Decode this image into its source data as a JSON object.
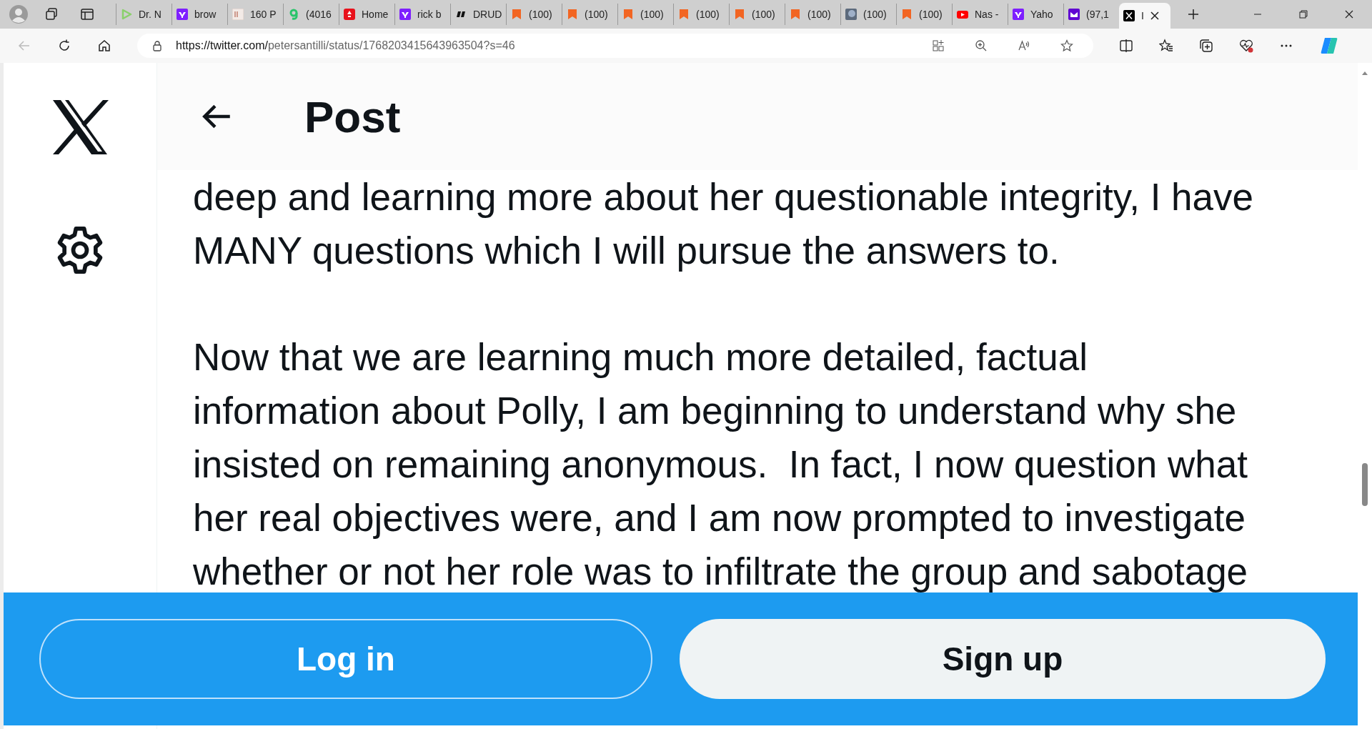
{
  "browser": {
    "tabs": [
      {
        "title": "Dr. N",
        "kind": "play",
        "selected": false
      },
      {
        "title": "brow",
        "kind": "yahoo",
        "selected": false
      },
      {
        "title": "160 P",
        "kind": "bi",
        "selected": false
      },
      {
        "title": "(4016",
        "kind": "g",
        "selected": false
      },
      {
        "title": "Home",
        "kind": "red",
        "selected": false
      },
      {
        "title": "rick b",
        "kind": "yahoo",
        "selected": false
      },
      {
        "title": "DRUD",
        "kind": "dr",
        "selected": false
      },
      {
        "title": "(100)",
        "kind": "bookmark",
        "selected": false
      },
      {
        "title": "(100)",
        "kind": "bookmark",
        "selected": false
      },
      {
        "title": "(100)",
        "kind": "bookmark",
        "selected": false
      },
      {
        "title": "(100)",
        "kind": "bookmark",
        "selected": false
      },
      {
        "title": "(100)",
        "kind": "bookmark",
        "selected": false
      },
      {
        "title": "(100)",
        "kind": "bookmark",
        "selected": false
      },
      {
        "title": "(100)",
        "kind": "moon",
        "selected": false
      },
      {
        "title": "(100)",
        "kind": "bookmark",
        "selected": false
      },
      {
        "title": "Nas -",
        "kind": "youtube",
        "selected": false
      },
      {
        "title": "Yaho",
        "kind": "yahoo",
        "selected": false
      },
      {
        "title": "(97,1",
        "kind": "mail",
        "selected": false
      },
      {
        "title": "I",
        "kind": "x",
        "selected": true
      }
    ],
    "url": {
      "host": "https://twitter.com/",
      "path": "petersantilli/status/1768203415643963504?s=46"
    }
  },
  "header": {
    "title": "Post"
  },
  "post": {
    "paragraphs": [
      [
        "deep and learning more about her questionable integrity, I have",
        "MANY questions which I will pursue the answers to."
      ],
      [
        "Now that we are learning much more detailed, factual",
        "information about Polly, I am beginning to understand why she",
        "insisted on remaining anonymous.  In fact, I now question what",
        "her real objectives were, and I am now prompted to investigate",
        "whether or not her role was to infiltrate the group and sabotage"
      ]
    ]
  },
  "login_bar": {
    "login": "Log in",
    "signup": "Sign up"
  }
}
